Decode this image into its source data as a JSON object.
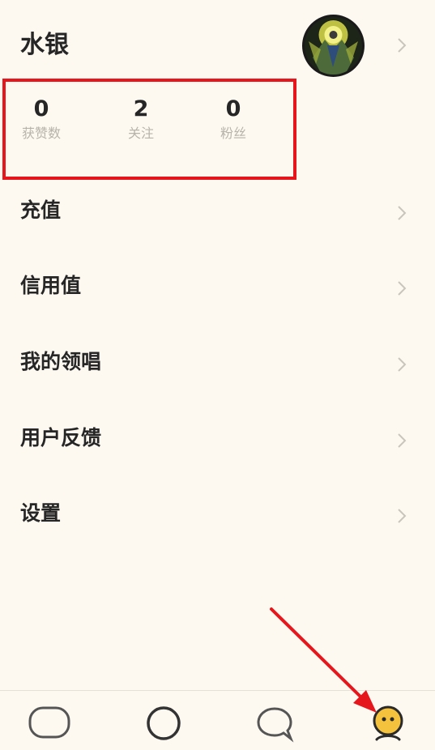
{
  "profile": {
    "username": "水银"
  },
  "stats": [
    {
      "value": "0",
      "label": "获赞数"
    },
    {
      "value": "2",
      "label": "关注"
    },
    {
      "value": "0",
      "label": "粉丝"
    }
  ],
  "menu": [
    {
      "label": "充值"
    },
    {
      "label": "信用值"
    },
    {
      "label": "我的领唱"
    },
    {
      "label": "用户反馈"
    },
    {
      "label": "设置"
    }
  ],
  "bottom_nav": [
    {
      "icon": "capsule-icon"
    },
    {
      "icon": "circle-icon"
    },
    {
      "icon": "chat-bubble-icon"
    },
    {
      "icon": "profile-face-icon",
      "active": true
    }
  ],
  "colors": {
    "background": "#fdf9f1",
    "highlight_box": "#e5161c",
    "active_nav": "#f4c23c",
    "annotation_arrow": "#e5161c"
  }
}
